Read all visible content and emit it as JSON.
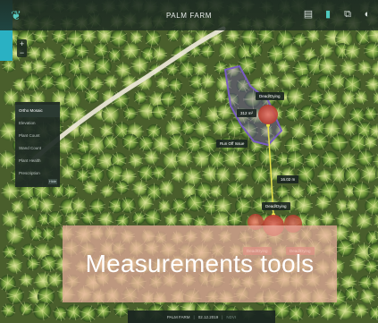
{
  "header": {
    "title": "PALM FARM",
    "logo_icon": "leaf-icon",
    "tools": [
      {
        "name": "document-icon",
        "active": false
      },
      {
        "name": "ruler-icon",
        "active": true
      },
      {
        "name": "layers-icon",
        "active": false
      },
      {
        "name": "user-icon",
        "active": false
      }
    ]
  },
  "zoom": {
    "plus": "+",
    "minus": "−"
  },
  "layers_panel": {
    "items": [
      "Ortho Mosaic",
      "Elevation",
      "Plant Count",
      "Stand Count",
      "Plant Health",
      "Prescription"
    ],
    "selected_index": 0,
    "footer": "Hide"
  },
  "map_labels": {
    "dead_dying_top": "Dead/Dying",
    "area_measure": "312 m²",
    "run_off": "Run Off Issue",
    "distance_measure": "16.02 m",
    "dead_dying_bottom": "Dead/Dying",
    "faded_left": "Dead/Dying",
    "faded_right": "Dead/Dying"
  },
  "caption": "Measurements tools",
  "status_bar": {
    "farm": "PALM FARM",
    "separator": "|",
    "date": "02.12.2019",
    "extra": "NDVI"
  },
  "colors": {
    "accent_teal": "#2ab1c3",
    "polygon_outline": "#7a5cc4",
    "measure_line": "#e9e24a",
    "problem_marker": "#d8503f"
  }
}
